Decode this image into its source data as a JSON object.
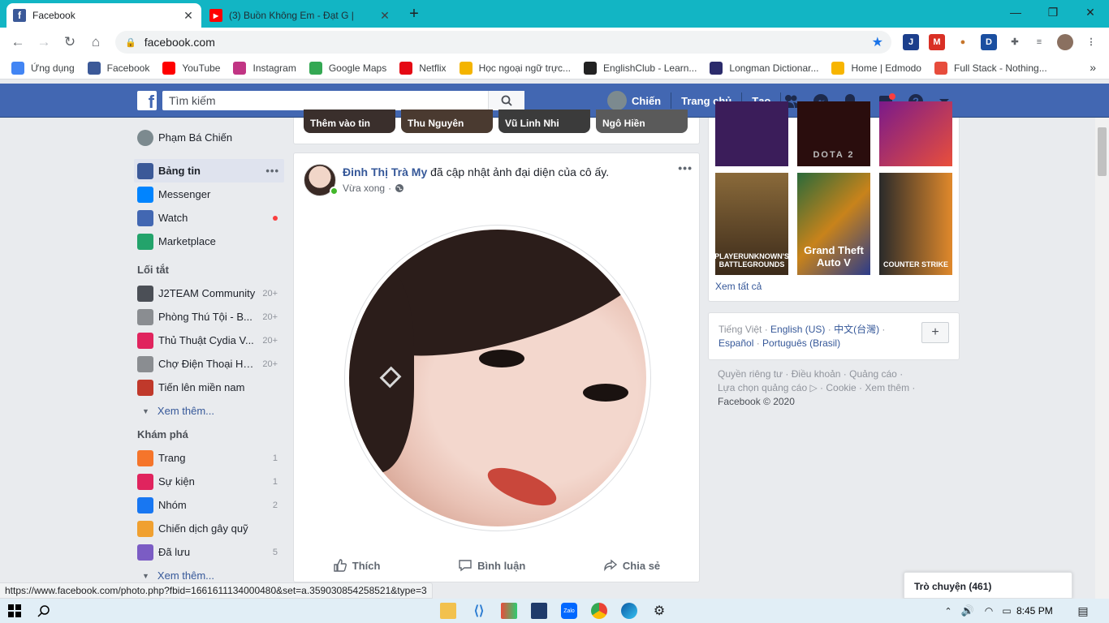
{
  "browser": {
    "tabs": [
      {
        "title": "Facebook",
        "icon": "facebook-icon"
      },
      {
        "title": "(3) Buồn Không Em - Đạt G |",
        "icon": "youtube-icon"
      }
    ],
    "new_tab": "+",
    "window_controls": [
      "—",
      "❐",
      "✕"
    ],
    "url": "facebook.com",
    "bookmarks": [
      {
        "label": "Ứng dụng",
        "icon": "apps-grid-icon",
        "color": "#4285f4"
      },
      {
        "label": "Facebook",
        "icon": "facebook-icon",
        "color": "#3b5998"
      },
      {
        "label": "YouTube",
        "icon": "youtube-icon",
        "color": "#ff0000"
      },
      {
        "label": "Instagram",
        "icon": "instagram-icon",
        "color": "#c13584"
      },
      {
        "label": "Google Maps",
        "icon": "maps-pin-icon",
        "color": "#34a853"
      },
      {
        "label": "Netflix",
        "icon": "netflix-icon",
        "color": "#e50914"
      },
      {
        "label": "Học ngoại ngữ trực...",
        "icon": "star-icon",
        "color": "#f4b400"
      },
      {
        "label": "EnglishClub - Learn...",
        "icon": "englishclub-icon",
        "color": "#222222"
      },
      {
        "label": "Longman Dictionar...",
        "icon": "longman-icon",
        "color": "#2b2b6b"
      },
      {
        "label": "Home | Edmodo",
        "icon": "edmodo-icon",
        "color": "#f7b500"
      },
      {
        "label": "Full Stack - Nothing...",
        "icon": "fullstack-icon",
        "color": "#e74c3c"
      }
    ],
    "status_url": "https://www.facebook.com/photo.php?fbid=1661611134000480&set=a.359030854258521&type=3"
  },
  "fb_header": {
    "search_placeholder": "Tìm kiếm",
    "user": "Chiến",
    "home": "Trang chủ",
    "create": "Tạo",
    "brand_color": "#4267b2"
  },
  "left_nav": {
    "profile": "Phạm Bá Chiến",
    "main": [
      {
        "label": "Bảng tin",
        "icon": "news-feed-icon",
        "active": true,
        "more": "•••"
      },
      {
        "label": "Messenger",
        "icon": "messenger-icon"
      },
      {
        "label": "Watch",
        "icon": "watch-icon",
        "dot": true
      },
      {
        "label": "Marketplace",
        "icon": "marketplace-icon"
      }
    ],
    "shortcuts_title": "Lối tắt",
    "shortcuts": [
      {
        "label": "J2TEAM Community",
        "count": "20+",
        "icon": "shield-icon"
      },
      {
        "label": "Phòng Thú Tội - B...",
        "count": "20+",
        "icon": "group-icon"
      },
      {
        "label": "Thủ Thuật Cydia V...",
        "count": "20+",
        "icon": "apple-icon"
      },
      {
        "label": "Chợ Điện Thoại Hà...",
        "count": "20+",
        "icon": "group-icon"
      },
      {
        "label": "Tiến lên miền nam",
        "count": "",
        "icon": "cards-icon"
      }
    ],
    "see_more": "Xem thêm...",
    "explore_title": "Khám phá",
    "explore": [
      {
        "label": "Trang",
        "count": "1",
        "icon": "flag-icon"
      },
      {
        "label": "Sự kiện",
        "count": "1",
        "icon": "calendar-icon"
      },
      {
        "label": "Nhóm",
        "count": "2",
        "icon": "groups-icon"
      },
      {
        "label": "Chiến dịch gây quỹ",
        "count": "",
        "icon": "fundraiser-icon"
      },
      {
        "label": "Đã lưu",
        "count": "5",
        "icon": "saved-icon"
      }
    ],
    "see_more2": "Xem thêm..."
  },
  "stories": [
    "Thêm vào tin",
    "Thu Nguyên",
    "Vũ Linh Nhi",
    "Ngô Hiền"
  ],
  "post": {
    "author": "Đinh Thị Trà My",
    "action": "đã cập nhật ảnh đại diện của cô ấy.",
    "time": "Vừa xong",
    "like": "Thích",
    "comment": "Bình luận",
    "share": "Chia sẻ"
  },
  "right_col": {
    "games": [
      "",
      "DOTA 2",
      "",
      "PLAYERUNKNOWN'S BATTLEGROUNDS",
      "Grand Theft Auto V",
      "COUNTER STRIKE"
    ],
    "see_all": "Xem tất cả",
    "languages_current": "Tiếng Việt",
    "languages": [
      "English (US)",
      "中文(台灣)",
      "Español",
      "Português (Brasil)"
    ],
    "footer_links": [
      "Quyền riêng tư",
      "Điều khoản",
      "Quảng cáo",
      "Lựa chọn quảng cáo",
      "Cookie",
      "Xem thêm"
    ],
    "copyright": "Facebook © 2020"
  },
  "chat": {
    "label": "Trò chuyện (461)"
  },
  "taskbar": {
    "time": "8:45 PM"
  }
}
